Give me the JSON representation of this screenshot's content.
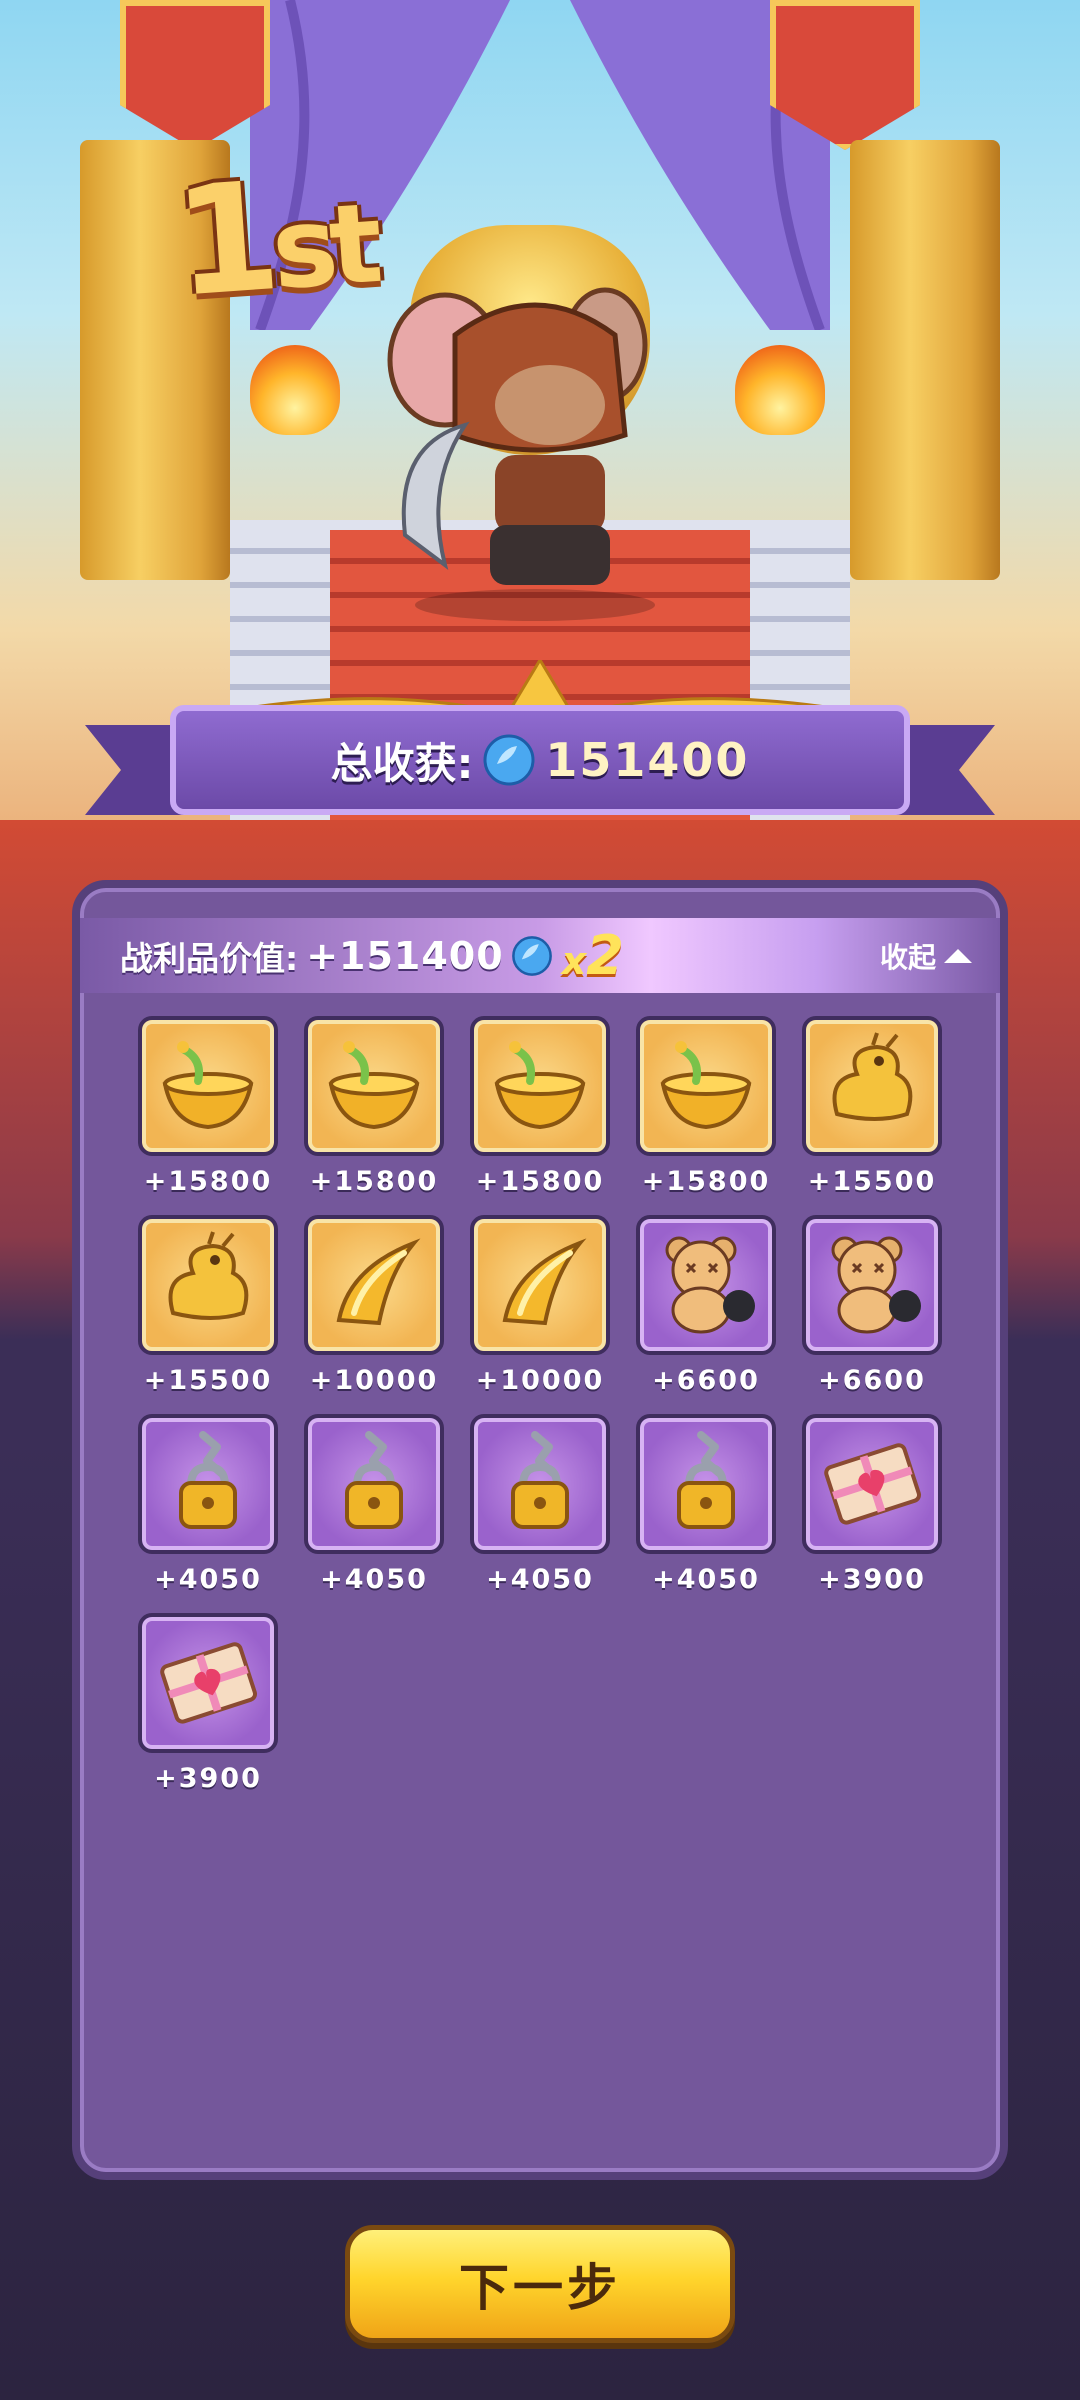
{
  "rank": {
    "number": "1",
    "suffix": "st"
  },
  "total": {
    "label": "总收获:",
    "value": "151400"
  },
  "loot": {
    "label": "战利品价值:",
    "value": "+151400",
    "multiplier_x": "x",
    "multiplier_n": "2",
    "collapse_label": "收起"
  },
  "items": [
    {
      "value": "+15800",
      "rarity": "gold",
      "icon": "golden-bowl-icon"
    },
    {
      "value": "+15800",
      "rarity": "gold",
      "icon": "golden-bowl-icon"
    },
    {
      "value": "+15800",
      "rarity": "gold",
      "icon": "golden-bowl-icon"
    },
    {
      "value": "+15800",
      "rarity": "gold",
      "icon": "golden-bowl-icon"
    },
    {
      "value": "+15500",
      "rarity": "gold",
      "icon": "golden-dragon-icon"
    },
    {
      "value": "+15500",
      "rarity": "gold",
      "icon": "golden-dragon-icon"
    },
    {
      "value": "+10000",
      "rarity": "gold",
      "icon": "golden-horn-icon"
    },
    {
      "value": "+10000",
      "rarity": "gold",
      "icon": "golden-horn-icon"
    },
    {
      "value": "+6600",
      "rarity": "purple",
      "icon": "teddy-bear-icon"
    },
    {
      "value": "+6600",
      "rarity": "purple",
      "icon": "teddy-bear-icon"
    },
    {
      "value": "+4050",
      "rarity": "purple",
      "icon": "chain-padlock-icon"
    },
    {
      "value": "+4050",
      "rarity": "purple",
      "icon": "chain-padlock-icon"
    },
    {
      "value": "+4050",
      "rarity": "purple",
      "icon": "chain-padlock-icon"
    },
    {
      "value": "+4050",
      "rarity": "purple",
      "icon": "chain-padlock-icon"
    },
    {
      "value": "+3900",
      "rarity": "purple",
      "icon": "love-letter-icon"
    },
    {
      "value": "+3900",
      "rarity": "purple",
      "icon": "love-letter-icon"
    }
  ],
  "next_button": {
    "label": "下一步"
  },
  "colors": {
    "panel": "#74579b",
    "gold_tile": "#f2b553",
    "purple_tile": "#9a62cc",
    "button": "#ffd52c"
  }
}
